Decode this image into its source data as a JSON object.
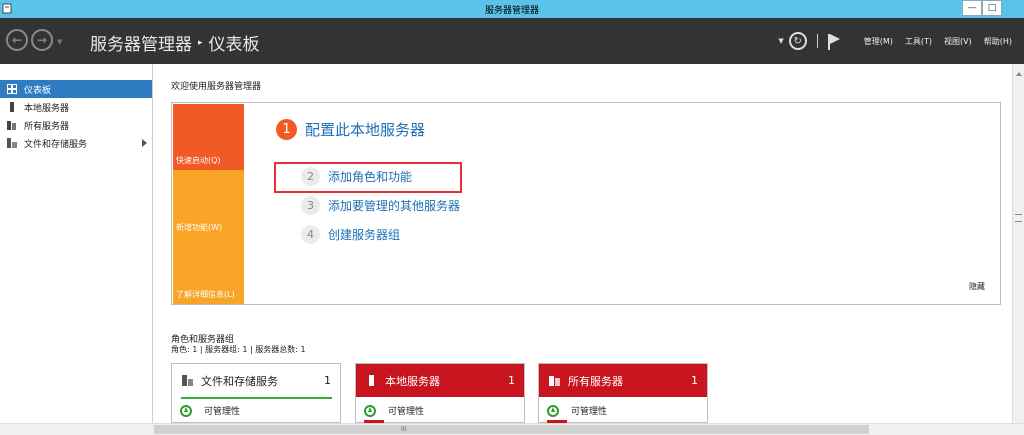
{
  "window": {
    "title": "服务器管理器",
    "controls": [
      "—",
      "□"
    ]
  },
  "header": {
    "breadcrumb_root": "服务器管理器",
    "breadcrumb_separator": "▸",
    "breadcrumb_current": "仪表板",
    "menu": [
      "管理(M)",
      "工具(T)",
      "视图(V)",
      "帮助(H)"
    ]
  },
  "sidebar": {
    "items": [
      {
        "label": "仪表板",
        "icon": "dashboard-icon",
        "active": true
      },
      {
        "label": "本地服务器",
        "icon": "local-server-icon",
        "active": false
      },
      {
        "label": "所有服务器",
        "icon": "all-servers-icon",
        "active": false
      },
      {
        "label": "文件和存储服务",
        "icon": "file-storage-icon",
        "active": false,
        "expandable": true
      }
    ]
  },
  "main": {
    "welcome_title": "欢迎使用服务器管理器",
    "tiles": [
      "快速启动(Q)",
      "新增功能(W)",
      "了解详细信息(L)"
    ],
    "steps": [
      {
        "num": "1",
        "label": "配置此本地服务器"
      },
      {
        "num": "2",
        "label": "添加角色和功能"
      },
      {
        "num": "3",
        "label": "添加要管理的其他服务器"
      },
      {
        "num": "4",
        "label": "创建服务器组"
      }
    ],
    "hide_label": "隐藏",
    "roles_title": "角色和服务器组",
    "roles_subtitle": "角色: 1 | 服务器组: 1 | 服务器总数: 1",
    "cards": [
      {
        "title": "文件和存储服务",
        "count": "1",
        "status": "可管理性",
        "style": "normal"
      },
      {
        "title": "本地服务器",
        "count": "1",
        "status": "可管理性",
        "style": "red"
      },
      {
        "title": "所有服务器",
        "count": "1",
        "status": "可管理性",
        "style": "red"
      }
    ]
  },
  "colors": {
    "title_bar": "#5bc3e8",
    "header": "#333333",
    "active_nav": "#2f7bc2",
    "tile_primary": "#f15a24",
    "tile_secondary": "#f7a427",
    "link": "#1e6fb7",
    "alert_red": "#c8141e",
    "ok_green": "#2e9a2e"
  }
}
